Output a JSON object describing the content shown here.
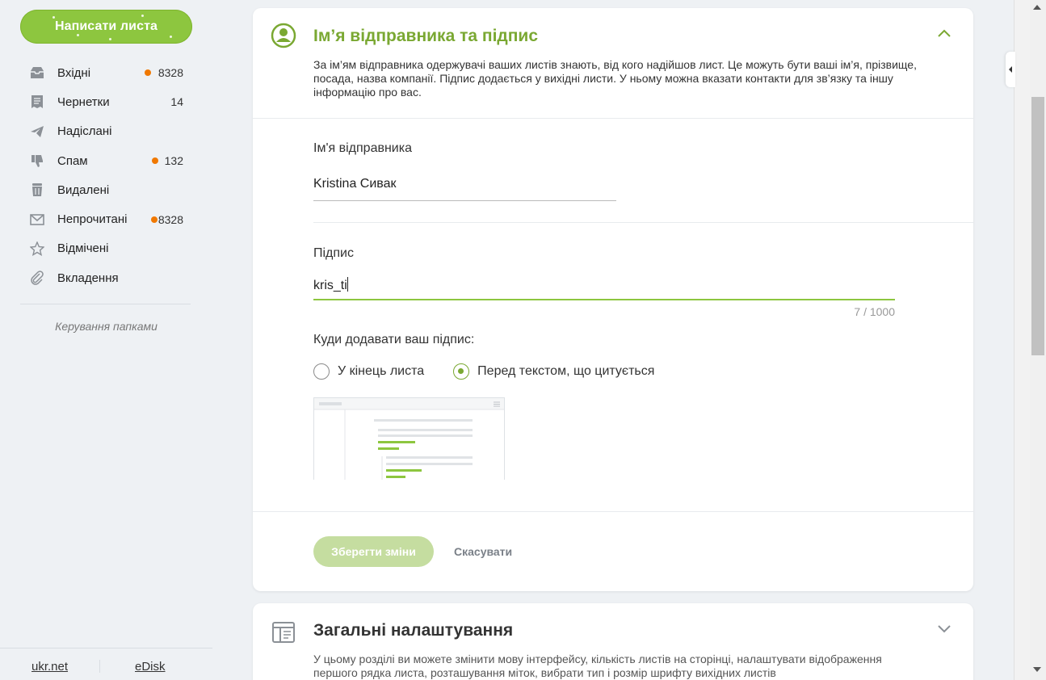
{
  "sidebar": {
    "compose_label": "Написати листа",
    "folders": [
      {
        "label": "Вхідні",
        "count": "8328",
        "badge": true,
        "icon": "inbox-icon"
      },
      {
        "label": "Чернетки",
        "count": "14",
        "badge": false,
        "icon": "drafts-icon"
      },
      {
        "label": "Надіслані",
        "count": "",
        "badge": false,
        "icon": "sent-icon"
      },
      {
        "label": "Спам",
        "count": "132",
        "badge": true,
        "icon": "spam-icon"
      },
      {
        "label": "Видалені",
        "count": "",
        "badge": false,
        "icon": "trash-icon"
      },
      {
        "label": "Непрочитані",
        "count": "8328",
        "badge": true,
        "icon": "unread-icon"
      },
      {
        "label": "Відмічені",
        "count": "",
        "badge": false,
        "icon": "star-icon"
      },
      {
        "label": "Вкладення",
        "count": "",
        "badge": false,
        "icon": "attachment-icon"
      }
    ],
    "manage_folders": "Керування папками",
    "footer_links": [
      "ukr.net",
      "eDisk"
    ]
  },
  "sender_card": {
    "title": "Ім’я відправника та підпис",
    "description": "За ім’ям відправника одержувачі ваших листів знають, від кого надійшов лист. Це можуть бути ваші ім’я, прізвище, посада, назва компанії. Підпис додається у вихідні листи. У ньому можна вказати контакти для зв’язку та іншу інформацію про вас.",
    "sender_label": "Ім'я відправника",
    "sender_value": "Kristina Сивак",
    "signature_label": "Підпис",
    "signature_value": "kris_ti",
    "signature_counter": "7 / 1000",
    "placement_label": "Куди додавати ваш підпис:",
    "placement_options": [
      {
        "label": "У кінець листа",
        "selected": false
      },
      {
        "label": "Перед текстом, що цитується",
        "selected": true
      }
    ],
    "save_label": "Зберегти зміни",
    "cancel_label": "Скасувати"
  },
  "general_card": {
    "title": "Загальні налаштування",
    "description": "У цьому розділі ви можете змінити мову інтерфейсу, кількість листів на сторінці, налаштувати відображення першого рядка листа, розташування міток, вибрати тип і розмір шрифту вихідних листів"
  },
  "colors": {
    "accent": "#8dc63f",
    "accent_dark": "#7aa832",
    "badge": "#f07800"
  }
}
